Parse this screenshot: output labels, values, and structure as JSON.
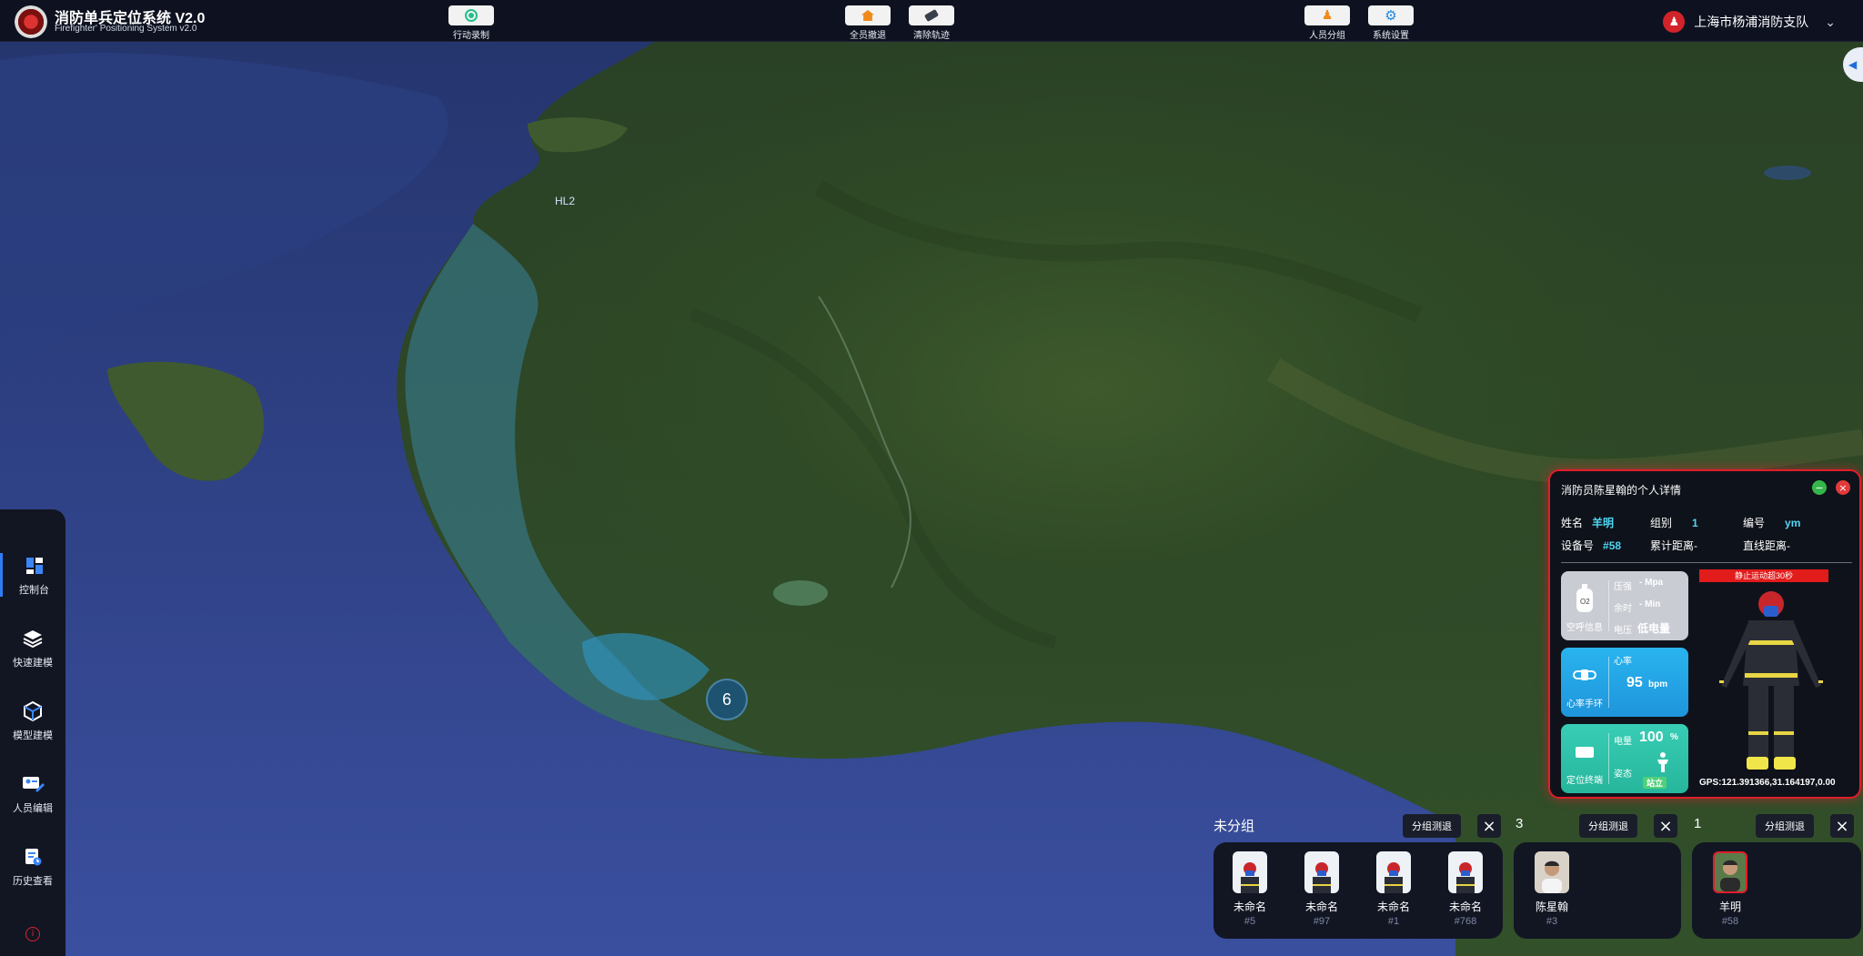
{
  "app": {
    "title": "消防单兵定位系统 V2.0",
    "subtitle": "Firefighter' Positioning System v2.0",
    "organization": "上海市杨浦消防支队"
  },
  "toolbar": {
    "record": "行动录制",
    "evacuate_all": "全员撤退",
    "clear_track": "清除轨迹",
    "grouping": "人员分组",
    "settings": "系统设置"
  },
  "map": {
    "label": "HL2",
    "cluster_count": "6"
  },
  "sidebar": {
    "items": [
      {
        "label": "控制台",
        "icon": "dashboard-icon"
      },
      {
        "label": "快速建模",
        "icon": "layers-icon"
      },
      {
        "label": "模型建模",
        "icon": "cube-icon"
      },
      {
        "label": "人员编辑",
        "icon": "user-edit-icon"
      },
      {
        "label": "历史查看",
        "icon": "history-icon"
      }
    ]
  },
  "panel": {
    "title": "消防员陈星翰的个人详情",
    "name_key": "姓名",
    "name_val": "羊明",
    "group_key": "组别",
    "group_val": "1",
    "code_key": "编号",
    "code_val": "ym",
    "device_key": "设备号",
    "device_val": "#58",
    "cum_dist": "累计距离-",
    "line_dist": "直线距离-",
    "air": {
      "name": "空呼信息",
      "pressure": "压强",
      "pressure_val": "- Mpa",
      "remaining": "余时",
      "remaining_val": "- Min",
      "voltage": "电压",
      "voltage_val": "低电量"
    },
    "heart": {
      "name": "心率手环",
      "label": "心率",
      "value": "95",
      "unit": "bpm"
    },
    "locator": {
      "name": "定位终端",
      "battery": "电量",
      "battery_val": "100",
      "battery_unit": "%",
      "posture": "姿态",
      "posture_val": "站立"
    },
    "alert": "静止运动超30秒",
    "gps": "GPS:121.391366,31.164197,0.00"
  },
  "groups": {
    "ungrouped_label": "未分组",
    "withdraw_label": "分组测退",
    "group3_label": "3",
    "group1_label": "1",
    "ungrouped": [
      {
        "name": "未命名",
        "no": "#5"
      },
      {
        "name": "未命名",
        "no": "#97"
      },
      {
        "name": "未命名",
        "no": "#1"
      },
      {
        "name": "未命名",
        "no": "#768"
      }
    ],
    "group3": [
      {
        "name": "陈星翰",
        "no": "#3"
      }
    ],
    "group1": [
      {
        "name": "羊明",
        "no": "#58"
      }
    ]
  },
  "colors": {
    "accent_red": "#e01e2a",
    "accent_blue": "#2f7df6",
    "value_cyan": "#4ed6f4"
  }
}
